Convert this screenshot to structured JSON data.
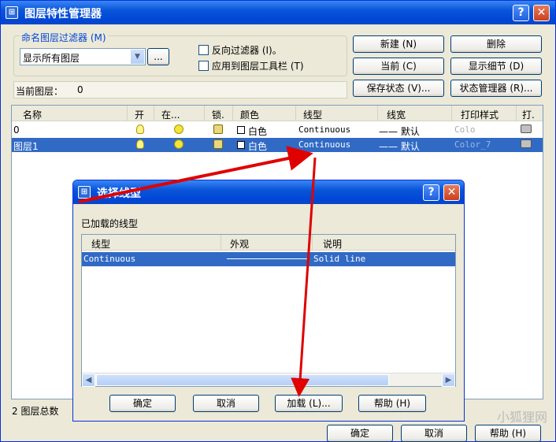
{
  "main": {
    "title": "图层特性管理器",
    "filter_group_label": "命名图层过滤器 (M)",
    "filter_value": "显示所有图层",
    "browse_label": "...",
    "reverse_filter_label": "反向过滤器 (I)。",
    "apply_toolbar_label": "应用到图层工具栏 (T)",
    "current_layer_label": "当前图层：",
    "current_layer_value": "0",
    "buttons": {
      "new": "新建 (N)",
      "delete": "删除",
      "current": "当前 (C)",
      "details": "显示细节 (D)",
      "save_state": "保存状态 (V)...",
      "state_manager": "状态管理器 (R)..."
    },
    "columns": [
      "名称",
      "开",
      "在...",
      "锁.",
      "颜色",
      "线型",
      "线宽",
      "打印样式",
      "打."
    ],
    "rows": [
      {
        "name": "0",
        "color": "白色",
        "linetype": "Continuous",
        "lineweight": "—— 默认",
        "plotstyle": "Colo"
      },
      {
        "name": "图层1",
        "color": "白色",
        "linetype": "Continuous",
        "lineweight": "—— 默认",
        "plotstyle": "Color_7"
      }
    ],
    "total_label": "2 图层总数",
    "ok": "确定",
    "cancel": "取消",
    "help": "帮助 (H)"
  },
  "dialog": {
    "title": "选择线型",
    "loaded_label": "已加载的线型",
    "columns": [
      "线型",
      "外观",
      "说明"
    ],
    "rows": [
      {
        "linetype": "Continuous",
        "description": "Solid line"
      }
    ],
    "ok": "确定",
    "cancel": "取消",
    "load": "加载 (L)...",
    "help": "帮助 (H)"
  },
  "watermark": "小狐狸网",
  "colors": {
    "title_bar": "#0a55d9",
    "selection": "#316ac5",
    "annotation_arrow": "#e00000"
  },
  "icons": [
    "layer-manager-icon",
    "help-icon",
    "close-icon",
    "bulb-icon",
    "sun-icon",
    "lock-icon",
    "printer-icon",
    "chevron-down-icon"
  ]
}
